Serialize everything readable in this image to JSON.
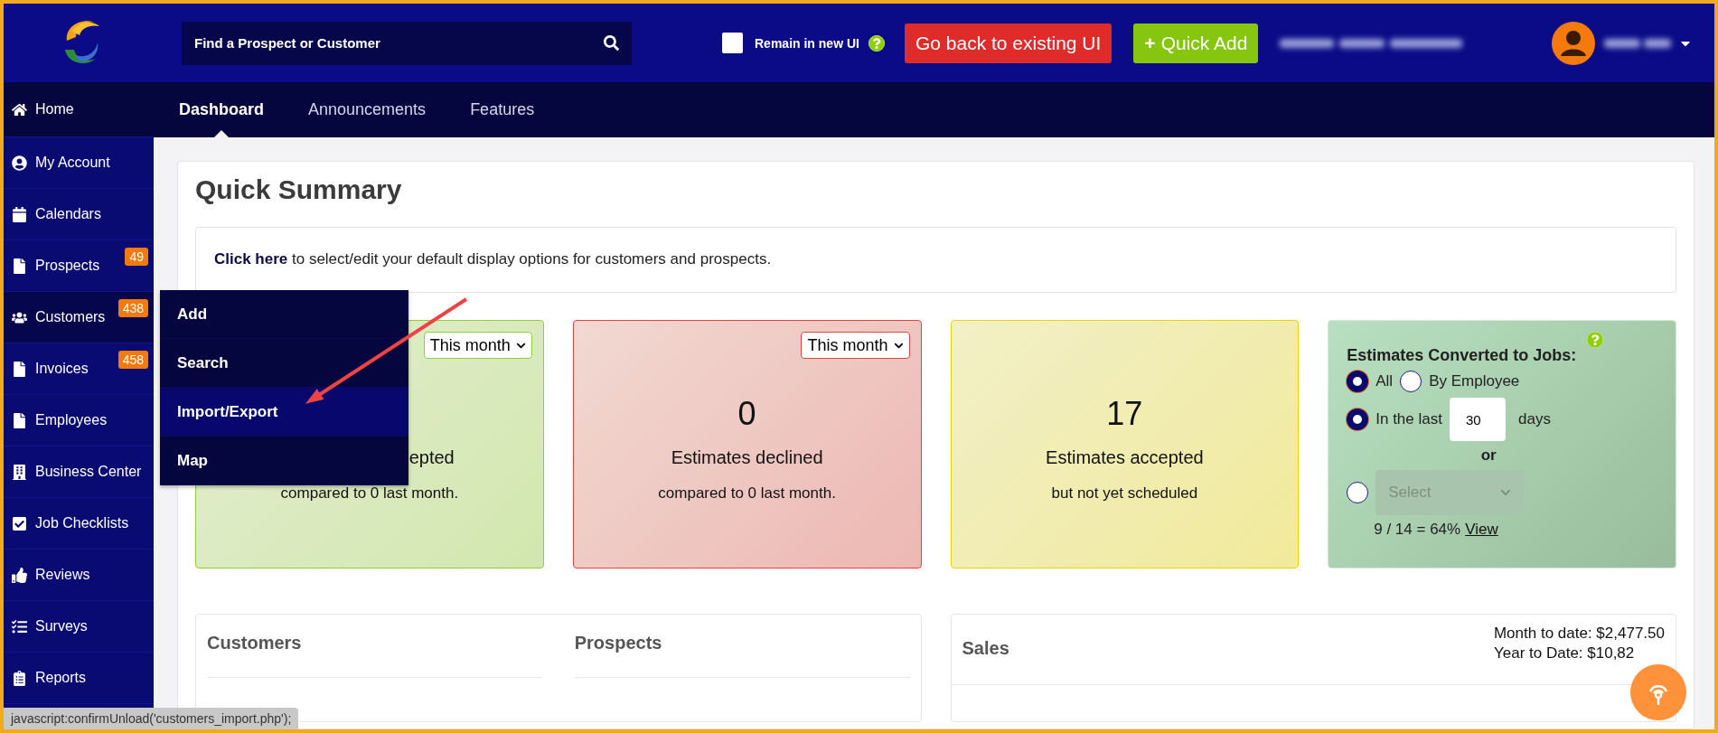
{
  "header": {
    "search": {
      "placeholder": "Find a Prospect or Customer"
    },
    "remain": {
      "label": "Remain in new UI",
      "checked": false
    },
    "back_button": "Go back to existing UI",
    "quick_add": {
      "icon": "+",
      "label": "Quick Add"
    }
  },
  "tabs": [
    {
      "label": "Dashboard",
      "selected": true
    },
    {
      "label": "Announcements",
      "selected": false
    },
    {
      "label": "Features",
      "selected": false
    }
  ],
  "sidebar": {
    "items": [
      {
        "label": "Home",
        "selected": false
      },
      {
        "label": "My Account",
        "selected": false
      },
      {
        "label": "Calendars",
        "selected": false
      },
      {
        "label": "Prospects",
        "badge": "49",
        "selected": false
      },
      {
        "label": "Customers",
        "badge": "438",
        "selected": true
      },
      {
        "label": "Invoices",
        "badge": "458",
        "selected": false
      },
      {
        "label": "Employees",
        "selected": false
      },
      {
        "label": "Business Center",
        "selected": false
      },
      {
        "label": "Job Checklists",
        "selected": false
      },
      {
        "label": "Reviews",
        "selected": false
      },
      {
        "label": "Surveys",
        "selected": false
      },
      {
        "label": "Reports",
        "selected": false
      }
    ]
  },
  "customers_menu": [
    {
      "label": "Add",
      "selected": false
    },
    {
      "label": "Search",
      "selected": false
    },
    {
      "label": "Import/Export",
      "selected": true
    },
    {
      "label": "Map",
      "selected": false
    }
  ],
  "summary": {
    "title": "Quick Summary",
    "notice": "**Click here** to select/edit your default display options for customers and prospects.",
    "cards": [
      {
        "color": "#8fce3a",
        "period": "This month",
        "label": "epted",
        "cut": true,
        "subtitle": "compared to 0 last month."
      },
      {
        "color": "#e04545",
        "period": "This month",
        "value": "0",
        "label": "Estimates declined",
        "subtitle": "compared to 0 last month."
      },
      {
        "color": "#e9d600",
        "value": "17",
        "label": "Estimates accepted",
        "subtitle": "but not yet scheduled"
      }
    ],
    "conversion": {
      "title": "Estimates Converted to Jobs:",
      "scope": [
        {
          "label": "All",
          "selected": true
        },
        {
          "label": "By Employee",
          "selected": false
        }
      ],
      "last": {
        "label": "In the last",
        "selected": true,
        "value": "30",
        "unit": "days"
      },
      "or": "or",
      "range": {
        "selected": false,
        "placeholder": "Select",
        "disabled": true
      },
      "ratio": "9 / 14 = 64%",
      "link": "View"
    }
  },
  "panels": {
    "customers": "Customers",
    "prospects": "Prospects",
    "sales": {
      "title": "Sales",
      "lines": [
        "Month to date: $2,477.50",
        "Year to Date: $10,82"
      ]
    }
  },
  "status_bar": "javascript:confirmUnload('customers_import.php');"
}
